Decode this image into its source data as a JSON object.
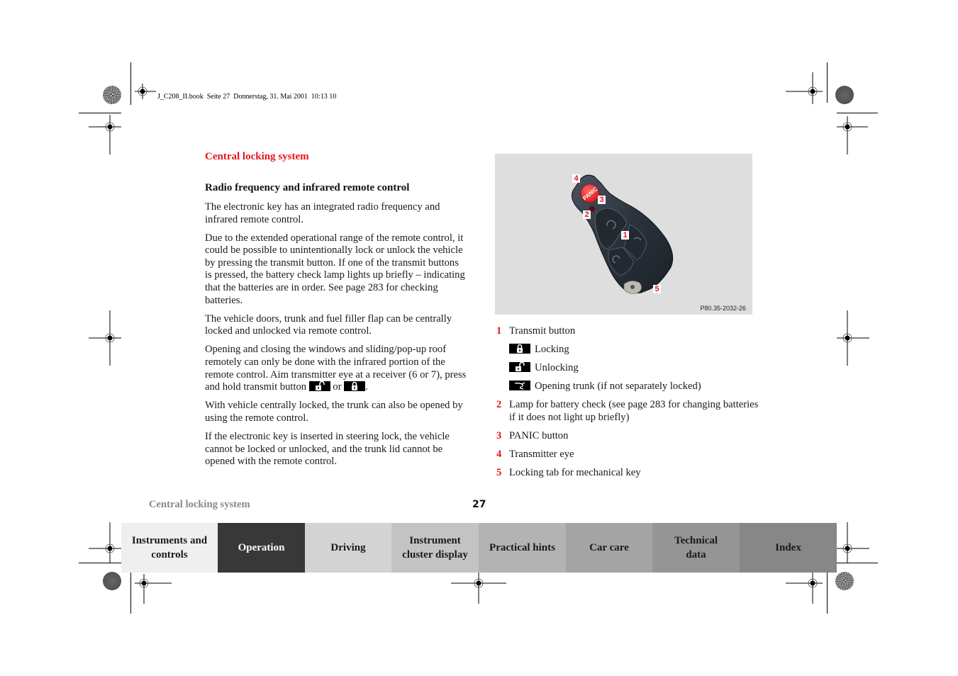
{
  "print_meta": "J_C208_II.book  Seite 27  Donnerstag, 31. Mai 2001  10:13 10",
  "section_title": "Central locking system",
  "subheading": "Radio frequency and infrared remote control",
  "paragraphs": {
    "p1": "The electronic key has an integrated radio frequency and infrared remote control.",
    "p2": "Due to the extended operational range of the remote control, it could be possible to unintentionally lock or unlock the vehicle by pressing the transmit button. If one of the transmit buttons is pressed, the battery check lamp lights up briefly – indicating that the batteries are in order. See page 283 for checking batteries.",
    "p3": "The vehicle doors, trunk and fuel filler flap can be centrally locked and unlocked via remote control.",
    "p4_before": "Opening and closing the windows and sliding/pop-up roof remotely can only be done with the infrared portion of the remote control. Aim transmitter eye at a receiver (6 or 7), press and hold transmit button ",
    "p4_or": " or ",
    "p4_end": ".",
    "p5": "With vehicle centrally locked, the trunk can also be opened by using the remote control.",
    "p6": "If the electronic key is inserted in steering lock, the vehicle cannot be locked or unlocked, and the trunk lid cannot be opened with the remote control."
  },
  "figure": {
    "code": "P80.35-2032-26",
    "panic_label": "PANIC",
    "callouts": [
      "1",
      "2",
      "3",
      "4",
      "5"
    ]
  },
  "legend": {
    "item1": {
      "num": "1",
      "label": "Transmit button"
    },
    "sub_lock": "Locking",
    "sub_unlock": "Unlocking",
    "sub_trunk": "Opening trunk (if not separately locked)",
    "item2": {
      "num": "2",
      "label": "Lamp for battery check (see page 283 for changing batteries if it does not light up briefly)"
    },
    "item3": {
      "num": "3",
      "label": "PANIC button"
    },
    "item4": {
      "num": "4",
      "label": "Transmitter eye"
    },
    "item5": {
      "num": "5",
      "label": "Locking tab for mechanical key"
    }
  },
  "footer": {
    "title": "Central locking system",
    "page_number": "27"
  },
  "tabs": [
    {
      "label": "Instruments and controls",
      "bg": "#efefef",
      "fg": "#1a1a1a",
      "active": false
    },
    {
      "label": "Operation",
      "bg": "#383838",
      "fg": "#ffffff",
      "active": true
    },
    {
      "label": "Driving",
      "bg": "#d3d3d3",
      "fg": "#1a1a1a",
      "active": false
    },
    {
      "label": "Instrument cluster display",
      "bg": "#c3c3c3",
      "fg": "#1a1a1a",
      "active": false
    },
    {
      "label": "Practical hints",
      "bg": "#b3b3b3",
      "fg": "#1a1a1a",
      "active": false
    },
    {
      "label": "Car care",
      "bg": "#a4a4a4",
      "fg": "#1a1a1a",
      "active": false
    },
    {
      "label": "Technical data",
      "bg": "#959595",
      "fg": "#1a1a1a",
      "active": false
    },
    {
      "label": "Index",
      "bg": "#878787",
      "fg": "#1a1a1a",
      "active": false
    }
  ],
  "colors": {
    "accent_red": "#e8141c",
    "footer_gray": "#8a8a8a"
  }
}
